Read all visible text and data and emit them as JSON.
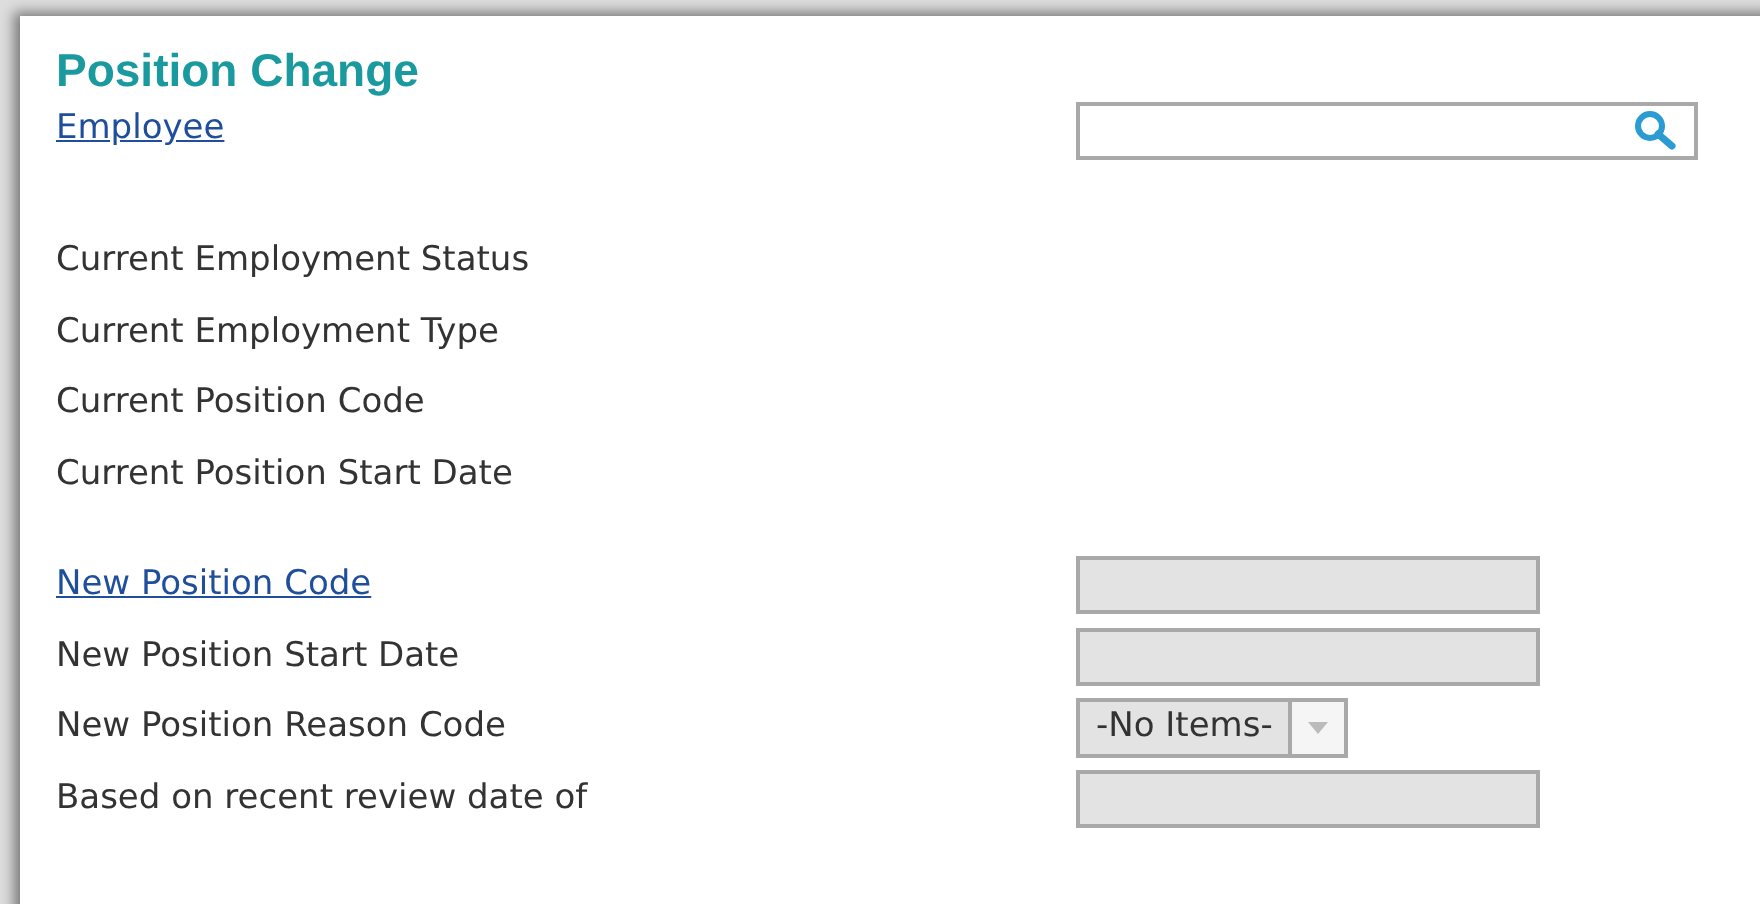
{
  "title": "Position Change",
  "employee": {
    "label": "Employee",
    "link": true
  },
  "current": [
    {
      "label": "Current Employment Status"
    },
    {
      "label": "Current Employment Type"
    },
    {
      "label": "Current Position Code"
    },
    {
      "label": "Current Position Start Date"
    }
  ],
  "new_fields": [
    {
      "label": "New Position Code",
      "link": true,
      "kind": "text",
      "disabled": true
    },
    {
      "label": "New Position Start Date",
      "link": false,
      "kind": "text",
      "disabled": true
    },
    {
      "label": "New Position Reason Code",
      "link": false,
      "kind": "select",
      "value": "-No Items-",
      "disabled": true
    },
    {
      "label": "Based on recent review date of",
      "link": false,
      "kind": "text",
      "disabled": true
    }
  ]
}
